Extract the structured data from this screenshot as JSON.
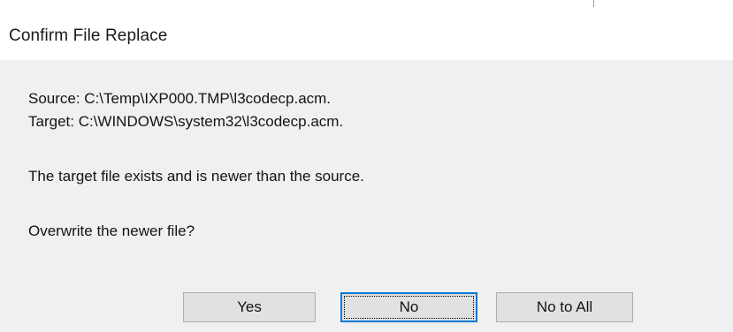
{
  "dialog": {
    "title": "Confirm File Replace",
    "source_line": "Source: C:\\Temp\\IXP000.TMP\\l3codecp.acm.",
    "target_line": "Target: C:\\WINDOWS\\system32\\l3codecp.acm.",
    "info_line": "The target file exists and is newer than the source.",
    "question_line": "Overwrite the newer file?"
  },
  "buttons": {
    "yes_label": "Yes",
    "no_label": "No",
    "no_to_all_label": "No to All"
  },
  "colors": {
    "body_background": "#f0f0f0",
    "button_face": "#e1e1e1",
    "default_button_border": "#0078d7"
  }
}
